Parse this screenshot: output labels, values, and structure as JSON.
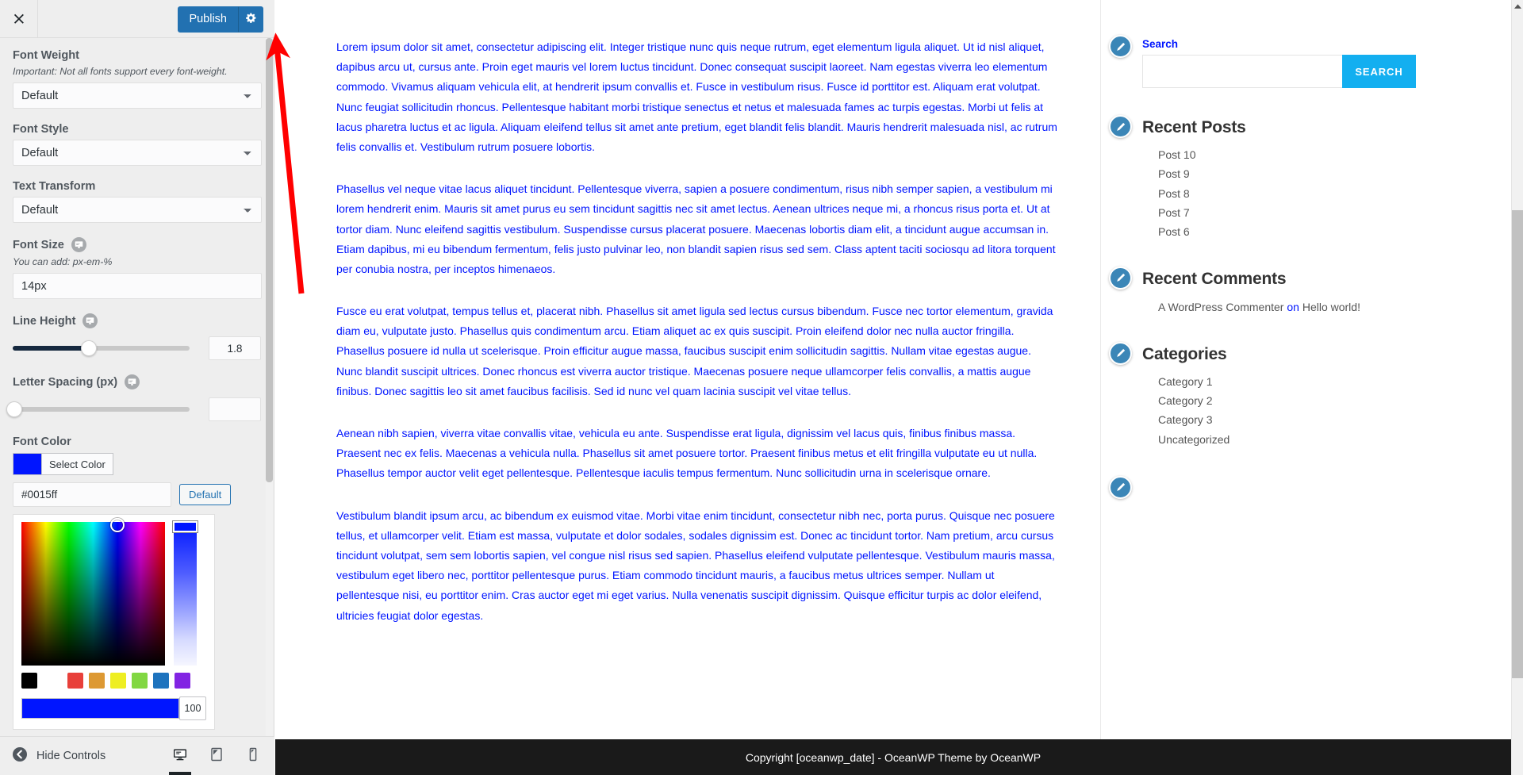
{
  "customizer": {
    "close_icon": "close-x-icon",
    "publish_label": "Publish",
    "gear_icon": "gear-icon",
    "hide_controls_label": "Hide Controls",
    "back_icon": "chevron-left-circle-icon",
    "devices": [
      {
        "name": "desktop",
        "icon": "desktop-icon",
        "active": true
      },
      {
        "name": "tablet",
        "icon": "tablet-icon",
        "active": false
      },
      {
        "name": "mobile",
        "icon": "mobile-icon",
        "active": false
      }
    ],
    "controls": {
      "font_weight": {
        "label": "Font Weight",
        "description": "Important: Not all fonts support every font-weight.",
        "value": "Default"
      },
      "font_style": {
        "label": "Font Style",
        "value": "Default"
      },
      "text_transform": {
        "label": "Text Transform",
        "value": "Default"
      },
      "font_size": {
        "label": "Font Size",
        "description": "You can add: px-em-%",
        "value": "14px",
        "responsive_icon": "responsive-device-icon"
      },
      "line_height": {
        "label": "Line Height",
        "value": "1.8",
        "responsive_icon": "responsive-device-icon",
        "fill_percent": 43
      },
      "letter_spacing": {
        "label": "Letter Spacing (px)",
        "value": "",
        "responsive_icon": "responsive-device-icon",
        "fill_percent": 0
      },
      "font_color": {
        "label": "Font Color",
        "select_color_label": "Select Color",
        "hex_value": "#0015ff",
        "default_label": "Default",
        "swatch_color": "#0015ff",
        "alpha_value": "100",
        "palette": [
          {
            "name": "black",
            "hex": "#000000"
          },
          {
            "name": "red",
            "hex": "#e8403a"
          },
          {
            "name": "orange",
            "hex": "#dd9933"
          },
          {
            "name": "yellow",
            "hex": "#eeee22"
          },
          {
            "name": "green",
            "hex": "#81d742"
          },
          {
            "name": "blue",
            "hex": "#1e73be"
          },
          {
            "name": "purple",
            "hex": "#8224e3"
          }
        ]
      }
    }
  },
  "preview": {
    "paragraphs": [
      "Lorem ipsum dolor sit amet, consectetur adipiscing elit. Integer tristique nunc quis neque rutrum, eget elementum ligula aliquet. Ut id nisl aliquet, dapibus arcu ut, cursus ante. Proin eget mauris vel lorem luctus tincidunt. Donec consequat suscipit laoreet. Nam egestas viverra leo elementum commodo. Vivamus aliquam vehicula elit, at hendrerit ipsum convallis et. Fusce in vestibulum risus. Fusce id porttitor est. Aliquam erat volutpat. Nunc feugiat sollicitudin rhoncus. Pellentesque habitant morbi tristique senectus et netus et malesuada fames ac turpis egestas. Morbi ut felis at lacus pharetra luctus et ac ligula. Aliquam eleifend tellus sit amet ante pretium, eget blandit felis blandit. Mauris hendrerit malesuada nisl, ac rutrum felis convallis et. Vestibulum rutrum posuere lobortis.",
      "Phasellus vel neque vitae lacus aliquet tincidunt. Pellentesque viverra, sapien a posuere condimentum, risus nibh semper sapien, a vestibulum mi lorem hendrerit enim. Mauris sit amet purus eu sem tincidunt sagittis nec sit amet lectus. Aenean ultrices neque mi, a rhoncus risus porta et. Ut at tortor diam. Nunc eleifend sagittis vestibulum. Suspendisse cursus placerat posuere. Maecenas lobortis diam elit, a tincidunt augue accumsan in. Etiam dapibus, mi eu bibendum fermentum, felis justo pulvinar leo, non blandit sapien risus sed sem. Class aptent taciti sociosqu ad litora torquent per conubia nostra, per inceptos himenaeos.",
      "Fusce eu erat volutpat, tempus tellus et, placerat nibh. Phasellus sit amet ligula sed lectus cursus bibendum. Fusce nec tortor elementum, gravida diam eu, vulputate justo. Phasellus quis condimentum arcu. Etiam aliquet ac ex quis suscipit. Proin eleifend dolor nec nulla auctor fringilla. Phasellus posuere id nulla ut scelerisque. Proin efficitur augue massa, faucibus suscipit enim sollicitudin sagittis. Nullam vitae egestas augue. Nunc blandit suscipit ultrices. Donec rhoncus est viverra auctor tristique. Maecenas posuere neque ullamcorper felis convallis, a mattis augue finibus. Donec sagittis leo sit amet faucibus facilisis. Sed id nunc vel quam lacinia suscipit vel vitae tellus.",
      "Aenean nibh sapien, viverra vitae convallis vitae, vehicula eu ante. Suspendisse erat ligula, dignissim vel lacus quis, finibus finibus massa. Praesent nec ex felis. Maecenas a vehicula nulla. Phasellus sit amet posuere tortor. Praesent finibus metus et elit fringilla vulputate eu ut nulla. Phasellus tempor auctor velit eget pellentesque. Pellentesque iaculis tempus fermentum. Nunc sollicitudin urna in scelerisque ornare.",
      "Vestibulum blandit ipsum arcu, ac bibendum ex euismod vitae. Morbi vitae enim tincidunt, consectetur nibh nec, porta purus. Quisque nec posuere tellus, et ullamcorper velit. Etiam est massa, vulputate et dolor sodales, sodales dignissim est. Donec ac tincidunt tortor. Nam pretium, arcu cursus tincidunt volutpat, sem sem lobortis sapien, vel congue nisl risus sed sapien. Phasellus eleifend vulputate pellentesque. Vestibulum mauris massa, vestibulum eget libero nec, porttitor pellentesque purus. Etiam commodo tincidunt mauris, a faucibus metus ultrices semper. Nullam ut pellentesque nisi, eu porttitor enim. Cras auctor eget mi eget varius. Nulla venenatis suscipit dignissim. Quisque efficitur turpis ac dolor eleifend, ultricies feugiat dolor egestas."
    ],
    "sidebar": {
      "search_widget": {
        "title": "Search",
        "input_placeholder": "",
        "input_value": "",
        "button_label": "SEARCH",
        "pencil_icon": "edit-pencil-icon"
      },
      "recent_posts_widget": {
        "title": "Recent Posts",
        "pencil_icon": "edit-pencil-icon",
        "items": [
          "Post 10",
          "Post 9",
          "Post 8",
          "Post 7",
          "Post 6"
        ]
      },
      "recent_comments_widget": {
        "title": "Recent Comments",
        "pencil_icon": "edit-pencil-icon",
        "comment_author": "A WordPress Commenter",
        "comment_on": "on",
        "comment_post": "Hello world!"
      },
      "categories_widget": {
        "title": "Categories",
        "pencil_icon": "edit-pencil-icon",
        "items": [
          "Category 1",
          "Category 2",
          "Category 3",
          "Uncategorized"
        ]
      },
      "extra_widget_pencil": "edit-pencil-icon"
    },
    "footer_copyright": "Copyright [oceanwp_date] - OceanWP Theme by OceanWP"
  },
  "annotation": {
    "arrow_color": "#ff0000",
    "arrow_name": "red-pointer-arrow"
  }
}
